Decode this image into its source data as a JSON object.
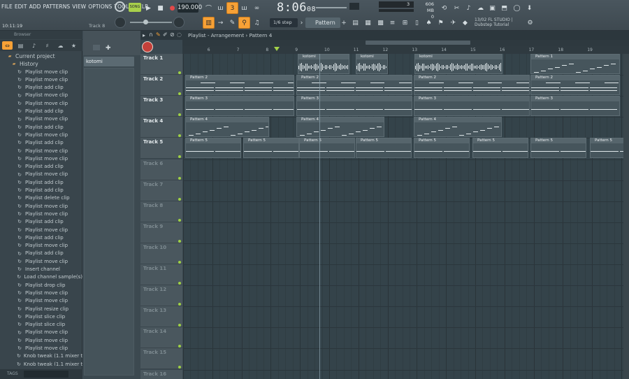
{
  "menu": [
    "FILE",
    "EDIT",
    "ADD",
    "PATTERNS",
    "VIEW",
    "OPTIONS",
    "TOOLS",
    "HELP"
  ],
  "transport": {
    "tempo": "190.000",
    "time_main": "8:06",
    "time_sub": "08",
    "clock": "10:11:19",
    "hint": "Track 8",
    "cpu_value": "3",
    "memory": "606 MB",
    "memory_sub": "0"
  },
  "toolbar2": {
    "snap": "1/6 step",
    "pattern": "Pattern 4",
    "news_line1": "13/02  FL STUDIO |",
    "news_line2": "Dubstep Tutorial"
  },
  "browser": {
    "title": "Browser",
    "current_project": "Current project",
    "history": "History",
    "items": [
      "Playlist move clip",
      "Playlist move clip",
      "Playlist add clip",
      "Playlist move clip",
      "Playlist move clip",
      "Playlist add clip",
      "Playlist move clip",
      "Playlist add clip",
      "Playlist move clip",
      "Playlist add clip",
      "Playlist move clip",
      "Playlist move clip",
      "Playlist add clip",
      "Playlist move clip",
      "Playlist add clip",
      "Playlist add clip",
      "Playlist delete clip",
      "Playlist move clip",
      "Playlist move clip",
      "Playlist add clip",
      "Playlist move clip",
      "Playlist add clip",
      "Playlist move clip",
      "Playlist add clip",
      "Playlist move clip",
      "Insert channel",
      "Load channel sample(s)",
      "Playlist drop clip",
      "Playlist move clip",
      "Playlist move clip",
      "Playlist resize clip",
      "Playlist slice clip",
      "Playlist slice clip",
      "Playlist move clip",
      "Playlist move clip",
      "Playlist move clip",
      "Knob tweak (1.1 mixer track)",
      "Knob tweak (1.1 mixer track)"
    ],
    "tags_label": "TAGS"
  },
  "picker": {
    "selected": "kotomi"
  },
  "playlist": {
    "breadcrumb": "Playlist - Arrangement › Pattern 4",
    "ruler": [
      "5",
      "6",
      "7",
      "8",
      "9",
      "10",
      "11",
      "12",
      "13",
      "14",
      "15",
      "16",
      "17",
      "18",
      "19"
    ],
    "tracks": [
      "Track 1",
      "Track 2",
      "Track 3",
      "Track 4",
      "Track 5",
      "Track 6",
      "Track 7",
      "Track 8",
      "Track 9",
      "Track 10",
      "Track 11",
      "Track 12",
      "Track 13",
      "Track 14",
      "Track 15",
      "Track 16"
    ],
    "clip_labels": {
      "audio": "kotomi",
      "p2": "Pattern 2",
      "p3": "Pattern 3",
      "p4": "Pattern 4",
      "p5": "Pattern 5",
      "p1": "Pattern 1"
    }
  },
  "colors": {
    "accent": "#f7a136",
    "track_dot": "#9fd144",
    "bg": "#34434a"
  }
}
